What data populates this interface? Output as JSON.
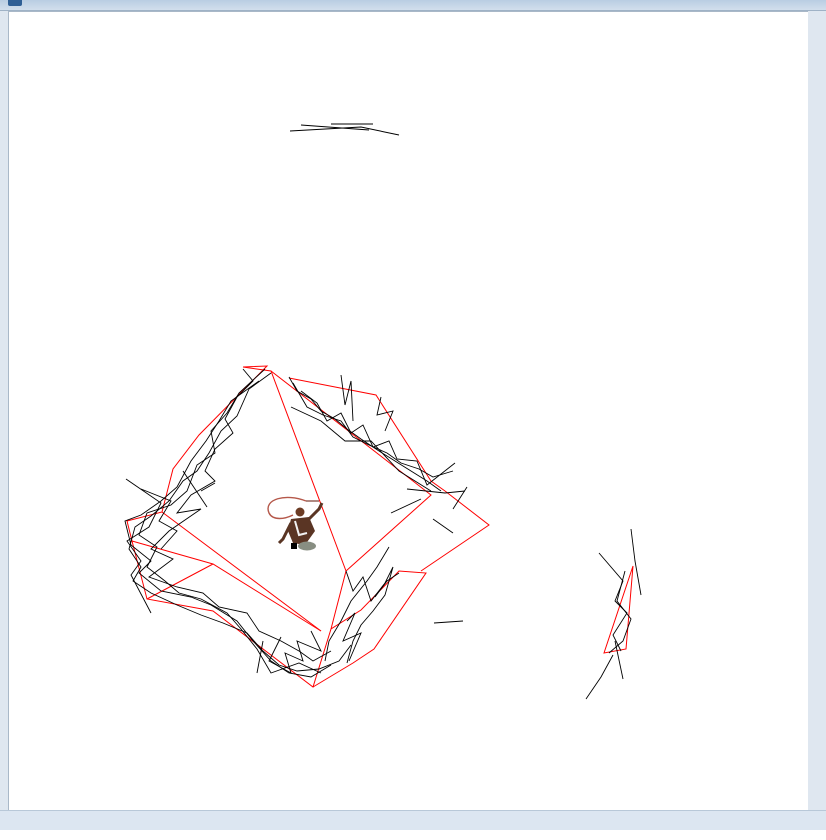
{
  "window": {
    "title": "",
    "icon": "app-icon"
  },
  "viewport": {
    "background": "#ffffff",
    "wall_line_color": "#000000",
    "mesh_color": "#ff0000",
    "character": {
      "description_icon": "whip-character-icon",
      "whip_color": "#b5584a",
      "marker_color": "#000000"
    }
  },
  "status_bar": {
    "text": ""
  }
}
